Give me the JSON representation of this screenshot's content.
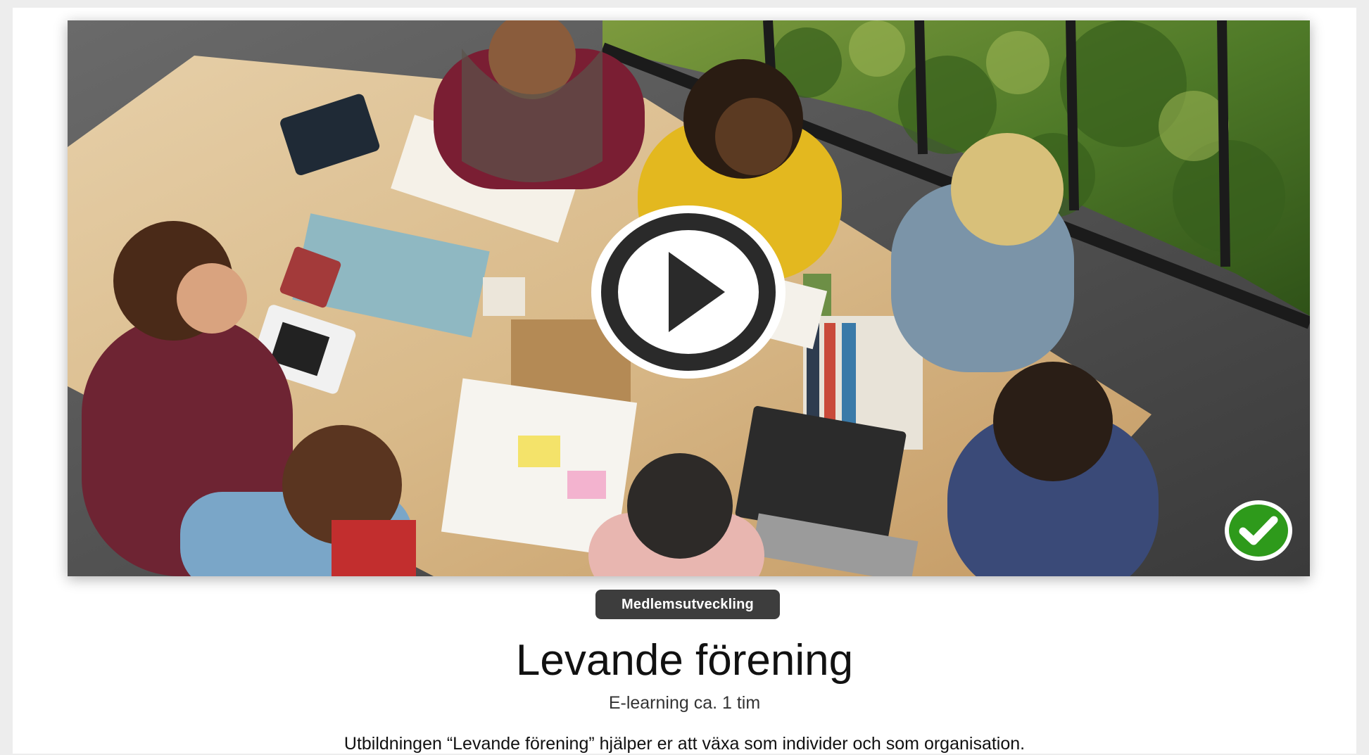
{
  "course": {
    "category": "Medlemsutveckling",
    "title": "Levande förening",
    "meta": "E-learning ca. 1 tim",
    "description": "Utbildningen “Levande förening” hjälper er att växa som individer och som organisation."
  },
  "video": {
    "play_icon": "play-circle-icon",
    "status_icon": "checkmark-circle-icon",
    "status_color": "#2e9a1b"
  },
  "theme": {
    "badge_bg": "#3d3d3d",
    "page_bg": "#ededed",
    "card_bg": "#ffffff"
  }
}
